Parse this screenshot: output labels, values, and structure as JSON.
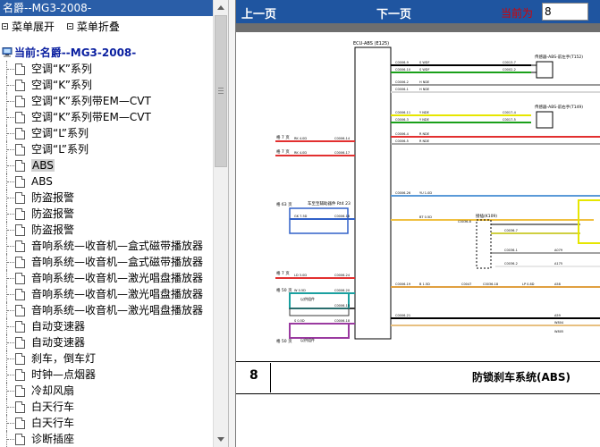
{
  "left_panel": {
    "title": "名爵--MG3-2008-",
    "actions": {
      "expand": "菜单展开",
      "collapse": "菜单折叠"
    },
    "tree_root": "当前:名爵--MG3-2008-",
    "items": [
      "空调“K”系列",
      "空调“K”系列",
      "空调“K”系列带EM—CVT",
      "空调“K”系列带EM—CVT",
      "空调“L”系列",
      "空调“L”系列",
      "ABS",
      "ABS",
      "防盗报警",
      "防盗报警",
      "防盗报警",
      "音响系统—收音机—盒式磁带播放器",
      "音响系统—收音机—盒式磁带播放器",
      "音响系统—收音机—激光唱盘播放器",
      "音响系统—收音机—激光唱盘播放器",
      "音响系统—收音机—激光唱盘播放器",
      "自动变速器",
      "自动变速器",
      "刹车，倒车灯",
      "时钟—点烟器",
      "冷却风扇",
      "白天行车",
      "白天行车",
      "诊断插座"
    ],
    "selected_index": 6
  },
  "nav": {
    "prev": "上一页",
    "next": "下一页",
    "current_label": "当前为",
    "current_page": "8"
  },
  "diagram": {
    "ecu_label": "ECU-ABS (E125)",
    "sensor_fl": "传感器-ABS-前左手(T152)",
    "sensor_fr": "传感器-ABS-前右手(T149)",
    "relay_label": "接插(K109)",
    "subtitle": "车至至辅助器件 Rt4 23",
    "page_tags": [
      {
        "text": "格 7 页",
        "sub": "B+"
      },
      {
        "text": "格 7 页",
        "sub": "B+"
      },
      {
        "text": "格 63 页",
        "sub": "B+"
      },
      {
        "text": "格 7 页",
        "sub": "B+"
      },
      {
        "text": "格 50 页",
        "sub": "B+"
      },
      {
        "text": "格 50 页",
        "sub": "B+"
      }
    ],
    "pin_labels": [
      "C0006-9",
      "C0006-10",
      "C0006-2",
      "C0006-1",
      "C0006-11",
      "C0006-3",
      "C0006-4",
      "C0006-5",
      "C0006-14",
      "C0006-17",
      "C0006-26",
      "C0006-16",
      "C0006-24",
      "C0006-20",
      "C0006-15",
      "C0006-18",
      "C0006-19",
      "C0006-21"
    ],
    "wire_labels": [
      "S WDF",
      "S WDF",
      "H NDE",
      "H NDE",
      "Y NDE",
      "Y NDE",
      "R NDE",
      "R NDE",
      "RK 4.0D",
      "RK 4.0D",
      "RK 7.5D",
      "YU 1.0D",
      "GK 7.5D",
      "BT 0.5D",
      "LD 3.0D",
      "W 0.5D",
      "S 0.5D",
      "B 1.5D",
      "LP 0.8D"
    ],
    "connector_labels": [
      "C0013-7",
      "C0002-2",
      "C0017-4",
      "C0017-5",
      "C0036-8",
      "C0036-7",
      "C0036-1",
      "C0036-2",
      "C0047",
      "C0036-18",
      "A079",
      "A175",
      "A58",
      "A59",
      "W804",
      "W805"
    ],
    "component_labels": [
      "以供组件",
      "以供组件"
    ]
  },
  "footer": {
    "page_number": "8",
    "system_name": "防锁刹车系统(ABS)"
  },
  "colors": {
    "title_bar": "#2a5ea8",
    "nav_bar": "#1f55a0",
    "selected_bg": "#d0d0d0",
    "tree_root_text": "#0a1fa0",
    "current_label_text": "#d80000"
  }
}
